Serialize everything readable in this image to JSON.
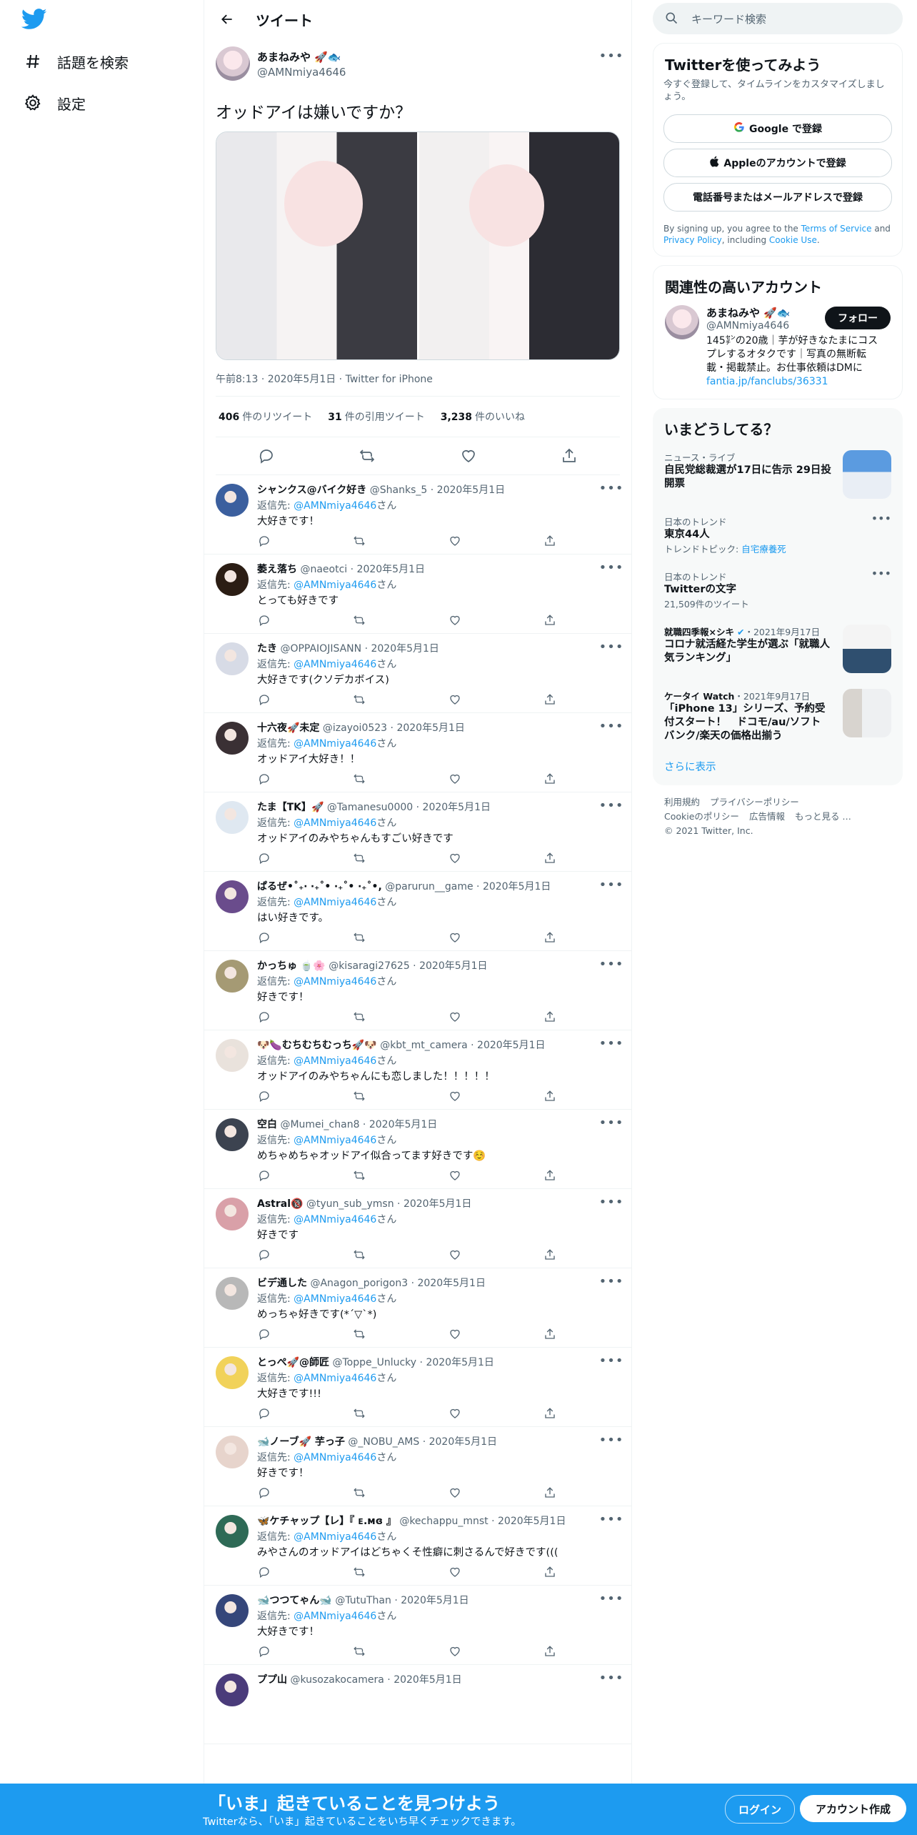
{
  "nav": {
    "items": [
      {
        "label": "話題を検索",
        "icon": "hashtag-icon"
      },
      {
        "label": "設定",
        "icon": "gear-icon"
      }
    ]
  },
  "header": {
    "title": "ツイート"
  },
  "main_tweet": {
    "name": "あまねみや",
    "handle": "@AMNmiya4646",
    "text": "オッドアイは嫌いですか？",
    "meta": "午前8:13 · 2020年5月1日 · Twitter for iPhone",
    "stats": [
      {
        "value": "406",
        "label": "件のリツイート"
      },
      {
        "value": "31",
        "label": "件の引用ツイート"
      },
      {
        "value": "3,238",
        "label": "件のいいね"
      }
    ]
  },
  "replies": [
    {
      "name": "シャンクス@バイク好き",
      "handle": "@Shanks_5",
      "date": "2020年5月1日",
      "to_label": "返信先: ",
      "to": "@AMNmiya4646",
      "suffix": "さん",
      "text": "大好きです！",
      "avatar_color": "#3b5f9e"
    },
    {
      "name": "萎え落ち",
      "handle": "@naeotci",
      "date": "2020年5月1日",
      "to_label": "返信先: ",
      "to": "@AMNmiya4646",
      "suffix": "さん",
      "text": "とっても好きです",
      "avatar_color": "#2b1d14"
    },
    {
      "name": "たき",
      "handle": "@OPPAIOJISANN",
      "date": "2020年5月1日",
      "to_label": "返信先: ",
      "to": "@AMNmiya4646",
      "suffix": "さん",
      "text": "大好きです(クソデカボイス)",
      "avatar_color": "#d7dbe6"
    },
    {
      "name": "十六夜🚀未定",
      "handle": "@izayoi0523",
      "date": "2020年5月1日",
      "to_label": "返信先: ",
      "to": "@AMNmiya4646",
      "suffix": "さん",
      "text": "オッドアイ大好き！！",
      "avatar_color": "#3a3034"
    },
    {
      "name": "たま【TK】🚀",
      "handle": "@Tamanesu0000",
      "date": "2020年5月1日",
      "to_label": "返信先: ",
      "to": "@AMNmiya4646",
      "suffix": "さん",
      "text": "オッドアイのみやちゃんもすごい好きです",
      "avatar_color": "#dfe8f1"
    },
    {
      "name": "ぱるぜ•˚₊‧ ‧₊˚• ‧₊˚• ‧₊˚•,",
      "handle": "@parurun__game",
      "date": "2020年5月1日",
      "to_label": "返信先: ",
      "to": "@AMNmiya4646",
      "suffix": "さん",
      "text": "はい好きです。",
      "avatar_color": "#6a4c8c"
    },
    {
      "name": "かっちゅ 🍵🌸",
      "handle": "@kisaragi27625",
      "date": "2020年5月1日",
      "to_label": "返信先: ",
      "to": "@AMNmiya4646",
      "suffix": "さん",
      "text": "好きです！",
      "avatar_color": "#a59a74"
    },
    {
      "name": "🐶🍆むちむちむっち🚀🐶",
      "handle": "@kbt_mt_camera",
      "date": "2020年5月1日",
      "to_label": "返信先: ",
      "to": "@AMNmiya4646",
      "suffix": "さん",
      "text": "オッドアイのみやちゃんにも恋しました！！！！！",
      "avatar_color": "#e9e2dc"
    },
    {
      "name": "空白",
      "handle": "@Mumei_chan8",
      "date": "2020年5月1日",
      "to_label": "返信先: ",
      "to": "@AMNmiya4646",
      "suffix": "さん",
      "text": "めちゃめちゃオッドアイ似合ってます好きです☺️",
      "avatar_color": "#3c4350"
    },
    {
      "name": "Astral🔞",
      "handle": "@tyun_sub_ymsn",
      "date": "2020年5月1日",
      "to_label": "返信先: ",
      "to": "@AMNmiya4646",
      "suffix": "さん",
      "text": "好きです",
      "avatar_color": "#d9a0a8"
    },
    {
      "name": "ビデ通した",
      "handle": "@Anagon_porigon3",
      "date": "2020年5月1日",
      "to_label": "返信先: ",
      "to": "@AMNmiya4646",
      "suffix": "さん",
      "text": "めっちゃ好きです(*´▽`*)",
      "avatar_color": "#b8b8b8"
    },
    {
      "name": "とっぺ🚀@師匠",
      "handle": "@Toppe_Unlucky",
      "date": "2020年5月1日",
      "to_label": "返信先: ",
      "to": "@AMNmiya4646",
      "suffix": "さん",
      "text": "大好きです!!!",
      "avatar_color": "#f1d25a"
    },
    {
      "name": "🐋ノーブ🚀 芋っ子",
      "handle": "@_NOBU_AMS",
      "date": "2020年5月1日",
      "to_label": "返信先: ",
      "to": "@AMNmiya4646",
      "suffix": "さん",
      "text": "好きです！",
      "avatar_color": "#e7d4cc"
    },
    {
      "name": "🦋ケチャップ【レ】『 ᴇ.ᴍɞ 』",
      "handle": "@kechappu_mnst",
      "date": "2020年5月1日",
      "to_label": "返信先: ",
      "to": "@AMNmiya4646",
      "suffix": "さん",
      "text": "みやさんのオッドアイはどちゃくそ性癖に刺さるんで好きです(((",
      "avatar_color": "#2e6a56"
    },
    {
      "name": "🐋つつてゃん🐋",
      "handle": "@TutuThan",
      "date": "2020年5月1日",
      "to_label": "返信先: ",
      "to": "@AMNmiya4646",
      "suffix": "さん",
      "text": "大好きです！",
      "avatar_color": "#35467a"
    },
    {
      "name": "ププ山",
      "handle": "@kusozakocamera",
      "date": "2020年5月1日",
      "to_label": "",
      "to": "",
      "suffix": "",
      "text": "",
      "avatar_color": "#4a3b7a"
    }
  ],
  "search": {
    "placeholder": "キーワード検索"
  },
  "signup": {
    "title": "Twitterを使ってみよう",
    "desc": "今すぐ登録して、タイムラインをカスタマイズしましょう。",
    "google": "Google で登録",
    "apple": "Appleのアカウントで登録",
    "phone": "電話番号またはメールアドレスで登録",
    "legal_pre": "By signing up, you agree to the ",
    "tos": "Terms of Service",
    "and": " and ",
    "privacy": "Privacy Policy",
    "including": ", including ",
    "cookie": "Cookie Use",
    "end": "."
  },
  "related": {
    "title": "関連性の高いアカウント",
    "name": "あまねみや",
    "handle": "@AMNmiya4646",
    "bio": "145㌢の20歳｜芋が好きなたまにコスプレするオタクです｜写真の無断転載・掲載禁止。お仕事依頼はDMに",
    "link": "fantia.jp/fanclubs/36331",
    "follow": "フォロー"
  },
  "trends": {
    "title": "いまどうしてる？",
    "items": [
      {
        "ctx": "ニュース・ライブ",
        "title": "自民党総裁選が17日に告示 29日投開票",
        "sub": "",
        "thumb": "#3a78c8"
      },
      {
        "ctx": "日本のトレンド",
        "title": "東京44人",
        "sub_pre": "トレンドトピック: ",
        "sub_link": "自宅療養死"
      },
      {
        "ctx": "日本のトレンド",
        "title": "Twitterの文字",
        "sub": "21,509件のツイート"
      },
      {
        "ctx_name": "就職四季報×シキ",
        "ctx_date": "・2021年9月17日",
        "title": "コロナ就活経た学生が選ぶ「就職人気ランキング」",
        "thumb": "#6f7784"
      },
      {
        "ctx_name": "ケータイ Watch",
        "ctx_date": "・2021年9月17日",
        "title": "「iPhone 13」シリーズ、予約受付スタート！　ドコモ/au/ソフトバンク/楽天の価格出揃う",
        "thumb": "#c9c4bd"
      }
    ],
    "more": "さらに表示"
  },
  "footer": {
    "links": [
      "利用規約",
      "プライバシーポリシー",
      "Cookieのポリシー",
      "広告情報",
      "もっと見る …"
    ],
    "copyright": "© 2021 Twitter, Inc."
  },
  "bottombar": {
    "title": "「いま」起きていることを見つけよう",
    "sub": "Twitterなら、「いま」起きていることをいち早くチェックできます。",
    "login": "ログイン",
    "create": "アカウント作成"
  }
}
